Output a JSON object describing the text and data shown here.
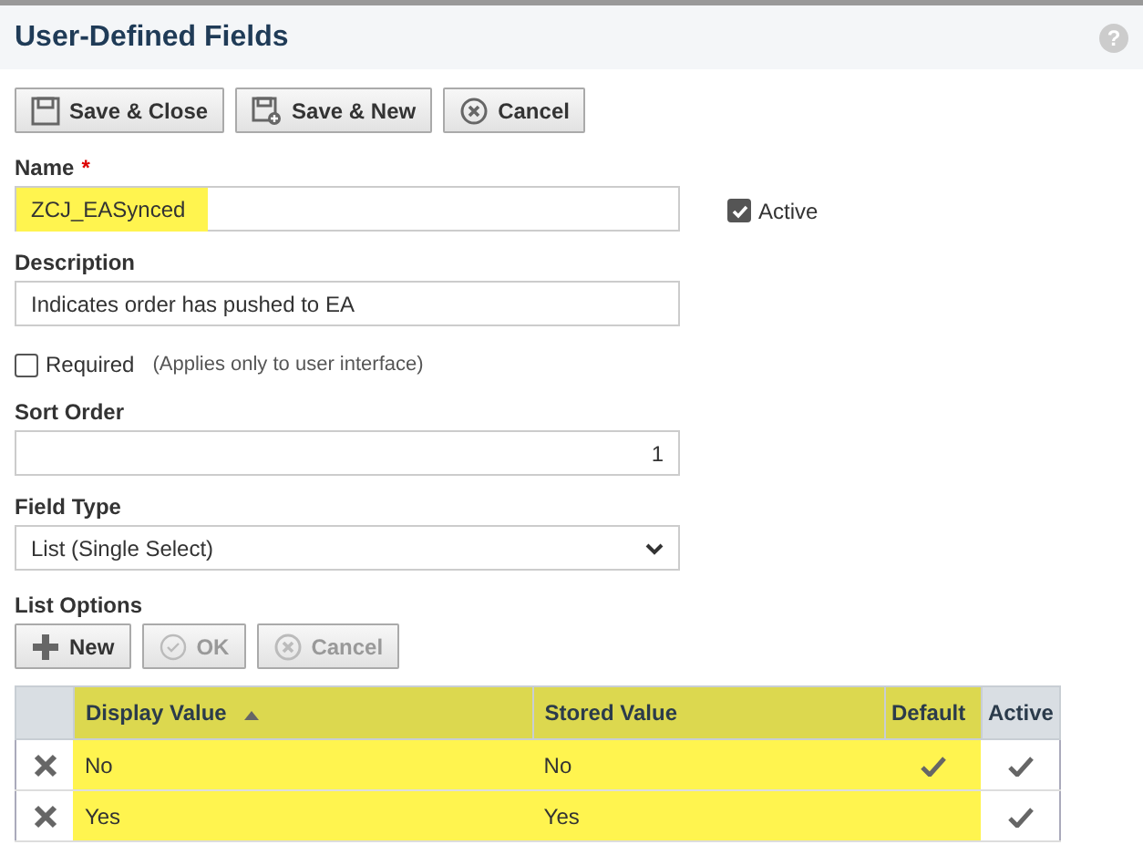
{
  "header": {
    "title": "User-Defined Fields",
    "help": "?"
  },
  "toolbar": [
    {
      "label": "Save & Close",
      "kind": "save",
      "disabled": false
    },
    {
      "label": "Save & New",
      "kind": "save-new",
      "disabled": false
    },
    {
      "label": "Cancel",
      "kind": "cancel",
      "disabled": false
    }
  ],
  "name": {
    "label": "Name",
    "required_mark": "*",
    "value": "ZCJ_EASynced",
    "highlighted": true
  },
  "active": {
    "label": "Active",
    "checked": true
  },
  "description": {
    "label": "Description",
    "value": "Indicates order has pushed to EA"
  },
  "required": {
    "label": "Required",
    "checked": false,
    "note": "(Applies only to user interface)"
  },
  "sort_order": {
    "label": "Sort Order",
    "value": "1"
  },
  "field_type": {
    "label": "Field Type",
    "value": "List (Single Select)"
  },
  "list_options": {
    "label": "List Options",
    "buttons": [
      {
        "label": "New",
        "kind": "plus",
        "disabled": false
      },
      {
        "label": "OK",
        "kind": "check",
        "disabled": true
      },
      {
        "label": "Cancel",
        "kind": "cancel",
        "disabled": true
      }
    ],
    "table": {
      "columns": [
        {
          "label": "Display Value",
          "sorted": true,
          "highlighted": true
        },
        {
          "label": "Stored Value",
          "sorted": false,
          "highlighted": true
        },
        {
          "label": "Default",
          "sorted": false,
          "highlighted": true
        },
        {
          "label": "Active",
          "sorted": false,
          "highlighted": false
        }
      ],
      "rows": [
        {
          "display": "No",
          "stored": "No",
          "default": true,
          "active": true
        },
        {
          "display": "Yes",
          "stored": "Yes",
          "default": false,
          "active": true
        }
      ]
    }
  }
}
